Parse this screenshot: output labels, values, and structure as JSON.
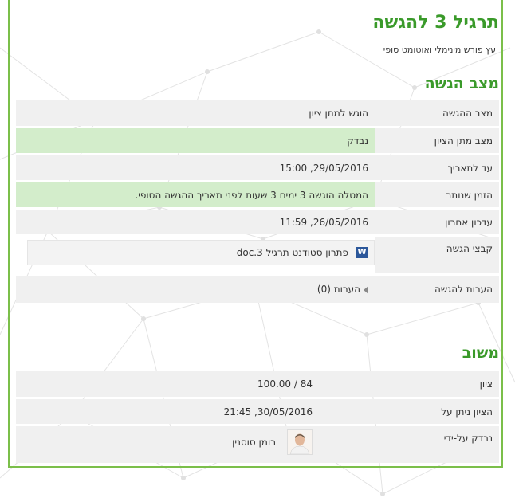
{
  "page": {
    "title": "תרגיל 3 להגשה",
    "subtitle": "עץ פורש מינימלי ואוטומט סופי"
  },
  "submission": {
    "heading": "מצב הגשה",
    "rows": [
      {
        "label": "מצב ההגשה",
        "value": "הוגש למתן ציון"
      },
      {
        "label": "מצב מתן הציון",
        "value": "נבדק"
      },
      {
        "label": "עד לתאריך",
        "value": "29/05/2016, 15:00"
      },
      {
        "label": "הזמן שנותר",
        "value": "המטלה הוגשה 3 ימים 3 שעות לפני תאריך ההגשה הסופי."
      },
      {
        "label": "עדכון אחרון",
        "value": "26/05/2016, 11:59"
      }
    ],
    "files_label": "קבצי הגשה",
    "file_name": "פתרון סטודנט תרגיל 3.doc",
    "file_icon": "word-doc-icon",
    "comments_label": "הערות להגשה",
    "comments_toggle": "הערות (0)"
  },
  "feedback": {
    "heading": "משוב",
    "rows": [
      {
        "label": "ציון",
        "value": "84 / 100.00"
      },
      {
        "label": "הציון ניתן על",
        "value": "30/05/2016, 21:45"
      }
    ],
    "grader_label": "נבדק על-ידי",
    "grader_name": "רומן סוסנין"
  },
  "colors": {
    "accent": "#3a9a2a",
    "border": "#7bbf4a",
    "row_bg": "#f0f0f0",
    "row_green": "#d3edcb"
  }
}
